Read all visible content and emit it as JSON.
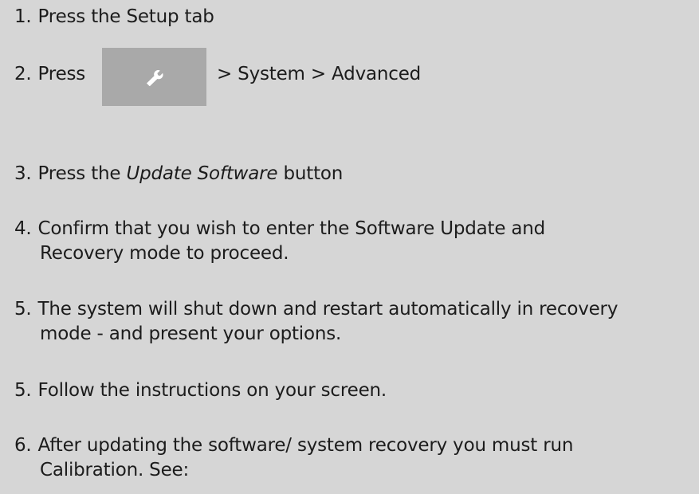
{
  "steps": [
    {
      "num": "1.",
      "text": "Press the Setup tab"
    },
    {
      "num": "2.",
      "pre": "Press",
      "post": "> System > Advanced",
      "icon": "wrench-icon"
    },
    {
      "num": "3.",
      "pre": "Press the ",
      "emphasis": "Update Software",
      "post": " button"
    },
    {
      "num": "4.",
      "line1": "Confirm that you wish to enter the Software Update and",
      "line2": "Recovery mode to proceed."
    },
    {
      "num": "5.",
      "line1": "The system will shut down and restart automatically in recovery",
      "line2": "mode - and present your options."
    },
    {
      "num": "5.",
      "text": "Follow the instructions on your screen."
    },
    {
      "num": "6.",
      "line1": "After updating the software/ system recovery you must run",
      "line2": "Calibration. See:"
    }
  ],
  "colors": {
    "background": "#d6d6d6",
    "button": "#a9a9a9",
    "icon": "#ffffff"
  }
}
